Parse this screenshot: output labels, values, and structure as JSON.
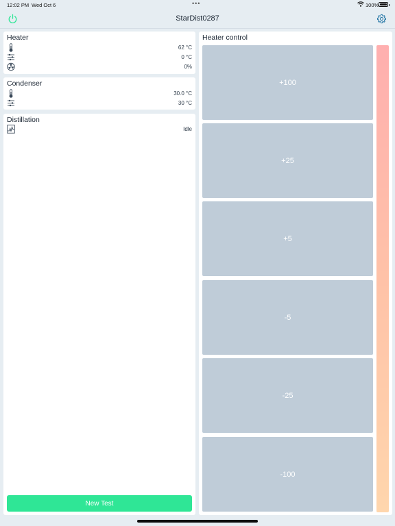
{
  "status_bar": {
    "time": "12:02 PM",
    "date": "Wed Oct 6",
    "dots": "•••",
    "battery_pct": "100%"
  },
  "nav": {
    "title": "StarDist0287",
    "power_icon": "power-icon",
    "settings_icon": "gear-icon",
    "accent_color": "#2fe696"
  },
  "heater": {
    "title": "Heater",
    "temperature": "62 °C",
    "setpoint": "0 °C",
    "power": "0%"
  },
  "condenser": {
    "title": "Condenser",
    "temperature": "30.0 °C",
    "setpoint": "30 °C"
  },
  "distillation": {
    "title": "Distillation",
    "status": "Idle",
    "new_test_label": "New Test"
  },
  "heater_control": {
    "title": "Heater control",
    "buttons": [
      "+100",
      "+25",
      "+5",
      "-5",
      "-25",
      "-100"
    ],
    "gradient_colors": [
      "#ffafaf",
      "#ffd6ad"
    ]
  }
}
